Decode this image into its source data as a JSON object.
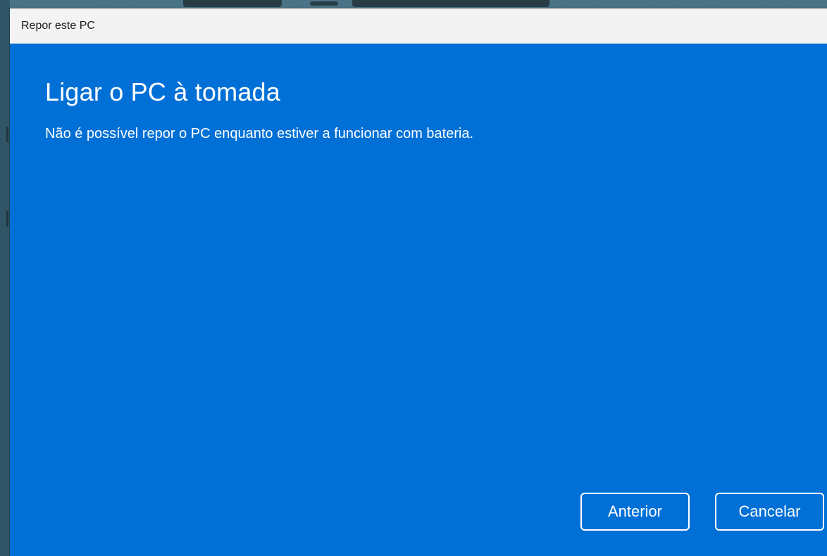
{
  "window": {
    "title": "Repor este PC"
  },
  "main": {
    "heading": "Ligar o PC à tomada",
    "message": "Não é possível repor o PC enquanto estiver a funcionar com bateria."
  },
  "buttons": {
    "back_label": "Anterior",
    "cancel_label": "Cancelar"
  },
  "colors": {
    "accent": "#0070d6",
    "titlebar": "#f3f3f3",
    "text_on_accent": "#ffffff"
  }
}
